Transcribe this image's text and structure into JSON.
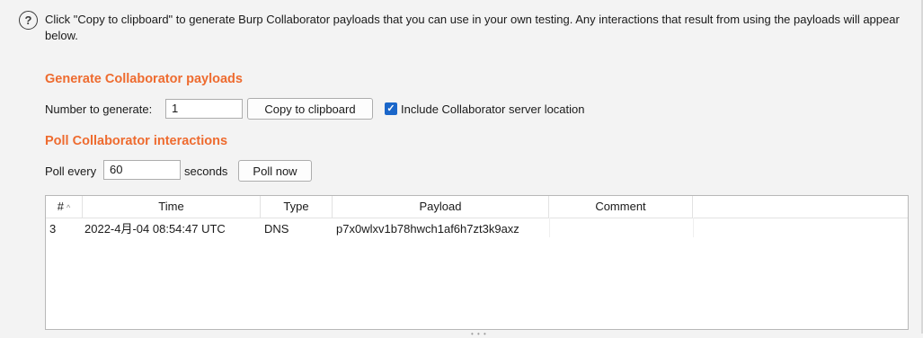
{
  "help": {
    "icon_glyph": "?",
    "text": "Click \"Copy to clipboard\" to generate Burp Collaborator payloads that you can use in your own testing. Any interactions that result from using the payloads will appear below."
  },
  "generate": {
    "title": "Generate Collaborator payloads",
    "number_label": "Number to generate:",
    "number_value": "1",
    "copy_button": "Copy to clipboard",
    "include_checked": true,
    "include_label": "Include Collaborator server location"
  },
  "poll": {
    "title": "Poll Collaborator interactions",
    "poll_every_label": "Poll every",
    "interval_value": "60",
    "seconds_label": "seconds",
    "poll_now_button": "Poll now"
  },
  "table": {
    "columns": [
      "#",
      "Time",
      "Type",
      "Payload",
      "Comment"
    ],
    "sort_indicator": "^",
    "rows": [
      {
        "num": "3",
        "time": "2022-4月-04 08:54:47 UTC",
        "type": "DNS",
        "payload": "p7x0wlxv1b78hwch1af6h7zt3k9axz",
        "comment": ""
      }
    ]
  },
  "colors": {
    "accent": "#ee6b2f",
    "checkbox": "#1a66c9"
  }
}
